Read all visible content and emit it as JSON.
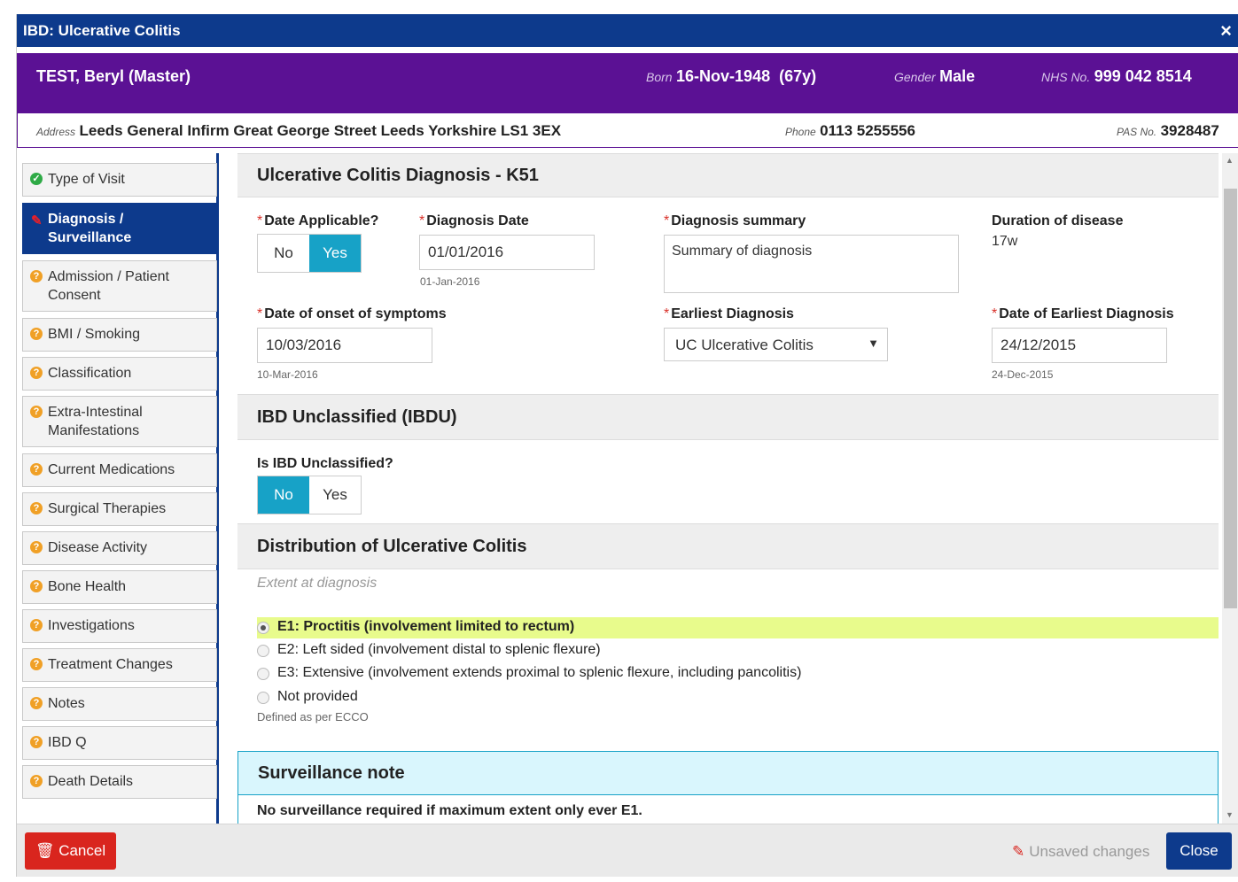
{
  "window": {
    "title": "IBD: Ulcerative Colitis",
    "close_icon": "×"
  },
  "patient": {
    "name": "TEST, Beryl (Master)",
    "born_label": "Born",
    "born_value": "16-Nov-1948  (67y)",
    "gender_label": "Gender",
    "gender_value": "Male",
    "nhs_label": "NHS No.",
    "nhs_value": "999 042 8514",
    "address_label": "Address",
    "address_value": "Leeds General Infirm Great George Street Leeds Yorkshire LS1 3EX",
    "phone_label": "Phone",
    "phone_value": "0113 5255556",
    "pas_label": "PAS No.",
    "pas_value": "3928487"
  },
  "sidebar": {
    "items": [
      {
        "label": "Type of Visit",
        "status": "complete"
      },
      {
        "label": "Diagnosis / Surveillance",
        "status": "active"
      },
      {
        "label": "Admission / Patient Consent",
        "status": "incomplete"
      },
      {
        "label": "BMI / Smoking",
        "status": "incomplete"
      },
      {
        "label": "Classification",
        "status": "incomplete"
      },
      {
        "label": "Extra-Intestinal Manifestations",
        "status": "incomplete"
      },
      {
        "label": "Current Medications",
        "status": "incomplete"
      },
      {
        "label": "Surgical Therapies",
        "status": "incomplete"
      },
      {
        "label": "Disease Activity",
        "status": "incomplete"
      },
      {
        "label": "Bone Health",
        "status": "incomplete"
      },
      {
        "label": "Investigations",
        "status": "incomplete"
      },
      {
        "label": "Treatment Changes",
        "status": "incomplete"
      },
      {
        "label": "Notes",
        "status": "incomplete"
      },
      {
        "label": "IBD Q",
        "status": "incomplete"
      },
      {
        "label": "Death Details",
        "status": "incomplete"
      }
    ]
  },
  "diagnosis": {
    "heading": "Ulcerative Colitis Diagnosis - K51",
    "date_applicable_label": "Date Applicable?",
    "date_applicable_no": "No",
    "date_applicable_yes": "Yes",
    "date_applicable_value": "Yes",
    "diagnosis_date_label": "Diagnosis Date",
    "diagnosis_date_value": "01/01/2016",
    "diagnosis_date_hint": "01-Jan-2016",
    "summary_label": "Diagnosis summary",
    "summary_value": "Summary of diagnosis",
    "duration_label": "Duration of disease",
    "duration_value": "17w",
    "onset_label": "Date of onset of symptoms",
    "onset_value": "10/03/2016",
    "onset_hint": "10-Mar-2016",
    "earliest_label": "Earliest Diagnosis",
    "earliest_value": "UC Ulcerative Colitis",
    "earliest_date_label": "Date of Earliest Diagnosis",
    "earliest_date_value": "24/12/2015",
    "earliest_date_hint": "24-Dec-2015"
  },
  "ibdu": {
    "heading": "IBD Unclassified (IBDU)",
    "question": "Is IBD Unclassified?",
    "no": "No",
    "yes": "Yes",
    "value": "No"
  },
  "distribution": {
    "heading": "Distribution of Ulcerative Colitis",
    "subheading": "Extent at diagnosis",
    "options": [
      "E1: Proctitis (involvement limited to rectum)",
      "E2: Left sided (involvement distal to splenic flexure)",
      "E3: Extensive (involvement extends proximal to splenic flexure, including pancolitis)",
      "Not provided"
    ],
    "selected": "E1: Proctitis (involvement limited to rectum)",
    "footnote": "Defined as per ECCO"
  },
  "surveillance": {
    "heading": "Surveillance note",
    "text": "No surveillance required if maximum extent only ever E1."
  },
  "footer": {
    "cancel_label": "Cancel",
    "unsaved_label": "Unsaved changes",
    "close_label": "Close"
  },
  "colors": {
    "header_blue": "#0d3a8c",
    "patient_purple": "#5b1194",
    "toggle_on": "#17a2c7",
    "cancel_red": "#d9251e",
    "highlight_yellow": "#e8fb8c"
  }
}
